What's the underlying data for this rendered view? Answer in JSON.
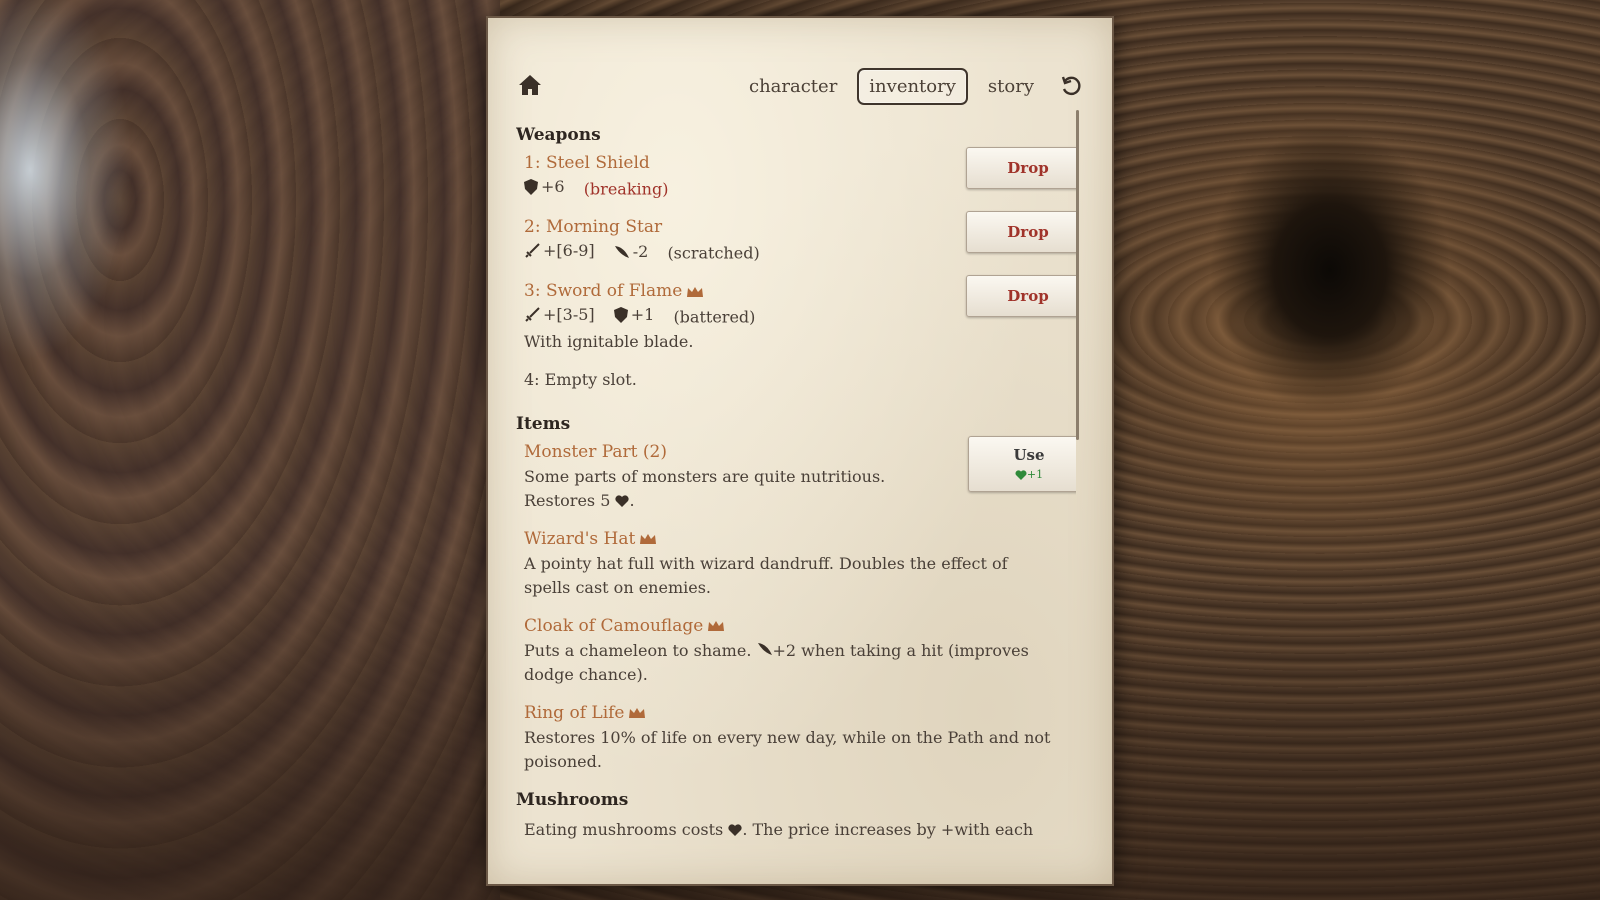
{
  "nav": {
    "tabs": [
      {
        "label": "character",
        "active": false
      },
      {
        "label": "inventory",
        "active": true
      },
      {
        "label": "story",
        "active": false
      }
    ]
  },
  "weapons": {
    "title": "Weapons",
    "items": [
      {
        "name": "1: Steel Shield",
        "stats": [
          "+6"
        ],
        "condition": "(breaking)",
        "action": "Drop"
      },
      {
        "name": "2: Morning Star",
        "stats": [
          "+[6-9]",
          "-2"
        ],
        "condition": "(scratched)",
        "action": "Drop"
      },
      {
        "name": "3: Sword of Flame",
        "stats": [
          "+[3-5]",
          "+1"
        ],
        "condition": "(battered)",
        "desc": "With ignitable blade.",
        "action": "Drop"
      },
      {
        "name": "4: Empty slot."
      }
    ]
  },
  "items": {
    "title": "Items",
    "list": [
      {
        "name": "Monster Part (2)",
        "desc": "Some parts of monsters are quite nutritious.",
        "desc2": "Restores 5",
        "action": "Use",
        "action_sub": "+1"
      },
      {
        "name": "Wizard's Hat",
        "desc": "A pointy hat full with wizard dandruff. Doubles the effect of spells cast on enemies."
      },
      {
        "name": "Cloak of Camouflage",
        "desc_a": "Puts a chameleon to shame.",
        "desc_b": "+2 when taking a hit (improves dodge chance)."
      },
      {
        "name": "Ring of Life",
        "desc": "Restores 10% of life on every new day, while on the Path and not poisoned."
      }
    ]
  },
  "mushrooms": {
    "title": "Mushrooms",
    "desc_a": "Eating mushrooms costs",
    "desc_b": ". The price increases by +with each"
  },
  "colors": {
    "item_name": "#b06a3a",
    "drop": "#a0332a",
    "heal": "#2f8a3a"
  }
}
